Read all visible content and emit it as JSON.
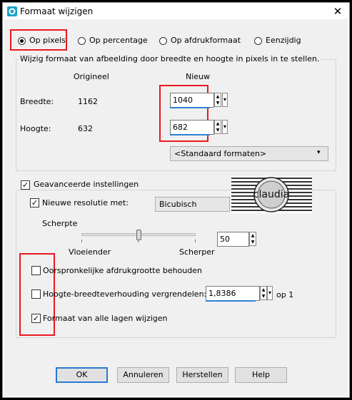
{
  "window": {
    "title": "Formaat wijzigen",
    "icon": "psp-app-icon",
    "close_symbol": "✕"
  },
  "mode_radios": [
    {
      "label": "Op pixels",
      "selected": true
    },
    {
      "label": "Op percentage",
      "selected": false
    },
    {
      "label": "Op afdrukformaat",
      "selected": false
    },
    {
      "label": "Eenzijdig",
      "selected": false
    }
  ],
  "pixel_group": {
    "caption": "Wijzig formaat van afbeelding door breedte en hoogte in pixels in te stellen.",
    "col_original": "Origineel",
    "col_new": "Nieuw",
    "width_label": "Breedte:",
    "width_original": "1162",
    "width_new": "1040",
    "height_label": "Hoogte:",
    "height_original": "632",
    "height_new": "682",
    "preset": "<Standaard formaten>"
  },
  "advanced": {
    "label": "Geavanceerde instellingen",
    "checked": true,
    "resample_label": "Nieuwe resolutie met:",
    "resample_checked": true,
    "resample_method": "Bicubisch",
    "sharpness_label": "Scherpte",
    "sharpness_value": "50",
    "sharpness_level": 0.5,
    "slider_left_label": "Vloeiender",
    "slider_right_label": "Scherper",
    "keep_print_size_label": "Oorspronkelijke afdrukgrootte behouden",
    "keep_print_size_checked": false,
    "lock_ratio_label": "Hoogte-breedteverhouding vergrendelen:",
    "lock_ratio_checked": false,
    "ratio_value": "1,8386",
    "ratio_suffix": "op 1",
    "all_layers_label": "Formaat van alle lagen wijzigen",
    "all_layers_checked": true
  },
  "preview_text": "claudia",
  "buttons": {
    "ok": "OK",
    "cancel": "Annuleren",
    "reset": "Herstellen",
    "help": "Help"
  },
  "colors": {
    "highlight": "#e8191f",
    "accent": "#2f7fd8",
    "title_icon": "#1aa3c8"
  }
}
